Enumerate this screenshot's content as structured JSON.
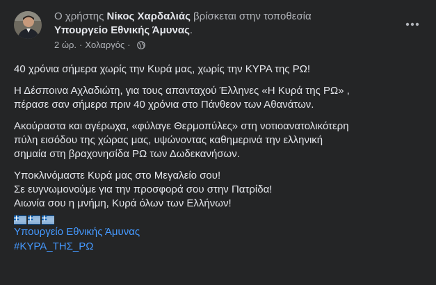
{
  "header": {
    "prefix": "Ο χρήστης ",
    "author": "Νίκος Χαρδαλιάς",
    "mid": " βρίσκεται στην τοποθεσία",
    "place": "Υπουργείο Εθνικής Άμυνας",
    "place_suffix": ".",
    "time": "2 ώρ.",
    "separator": "·",
    "location": "Χολαργός",
    "separator2": "·",
    "privacy_icon": "globe-icon",
    "more_icon": "more-horizontal-icon"
  },
  "post": {
    "p1": "40 χρόνια σήμερα χωρίς την Κυρά μας, χωρίς την ΚΥΡΑ της ΡΩ!",
    "p2_l1": "Η Δέσποινα Αχλαδιώτη, για τους απανταχού Έλληνες «Η Κυρά της ΡΩ» ,",
    "p2_l2": "πέρασε σαν σήμερα πριν 40 χρόνια στο Πάνθεον των Αθανάτων.",
    "p3_l1": "Ακούραστα και αγέρωχα, «φύλαγε Θερμοπύλες» στη νοτιοανατολικότερη",
    "p3_l2": "πύλη εισόδου της χώρας μας, υψώνοντας καθημερινά την ελληνική",
    "p3_l3": "σημαία στη βραχονησίδα ΡΩ των Δωδεκανήσων.",
    "p4_l1": "Υποκλινόμαστε Κυρά μας στο Μεγαλείο σου!",
    "p4_l2": "Σε ευγνωμονούμε για την προσφορά σου στην Πατρίδα!",
    "p4_l3": "Αιωνία σου η μνήμη, Κυρά όλων των Ελλήνων!",
    "flags": [
      "greek-flag-icon",
      "greek-flag-icon",
      "greek-flag-icon"
    ],
    "link_page": "Υπουργείο Εθνικής Άμυνας",
    "hashtag": "#ΚΥΡΑ_ΤΗΣ_ΡΩ"
  },
  "colors": {
    "background": "#242526",
    "text": "#e4e6eb",
    "secondary": "#b0b3b8",
    "link": "#4599ff",
    "flag_blue": "#0d5eaf"
  }
}
